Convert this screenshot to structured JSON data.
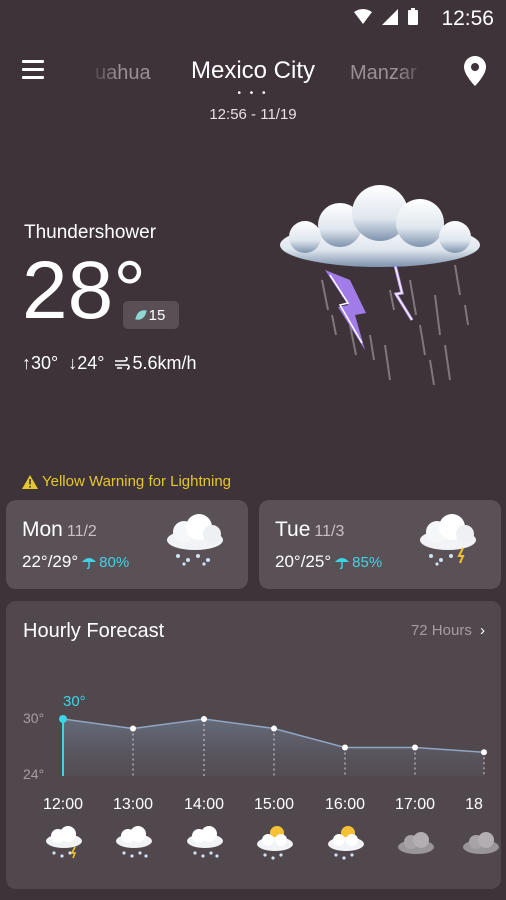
{
  "status_bar": {
    "time": "12:56"
  },
  "header": {
    "prev_city": "Chihuahua",
    "prev_city_visible": "uahua",
    "current_city": "Mexico City",
    "next_city": "Manzanillo",
    "next_city_visible": "Manzar",
    "page_dots": "• • •",
    "datetime": "12:56 - 11/19"
  },
  "current": {
    "condition": "Thundershower",
    "temperature": "28°",
    "aqi": "15",
    "high": "↑30°",
    "low": "↓24°",
    "wind": "5.6km/h"
  },
  "warning": {
    "text": "Yellow Warning for Lightning"
  },
  "daily": [
    {
      "day": "Mon",
      "date": "11/2",
      "temps": "22°/29°",
      "precip": "80%",
      "icon": "rain-cloud-icon"
    },
    {
      "day": "Tue",
      "date": "11/3",
      "temps": "20°/25°",
      "precip": "85%",
      "icon": "rain-thunder-cloud-icon"
    }
  ],
  "hourly": {
    "title": "Hourly Forecast",
    "link": "72 Hours",
    "max_label": "30°",
    "axis_high": "30°",
    "axis_low": "24°",
    "hours": [
      "12:00",
      "13:00",
      "14:00",
      "15:00",
      "16:00",
      "17:00",
      "18"
    ],
    "temps": [
      30,
      29,
      30,
      29,
      27,
      27,
      26.5
    ],
    "icons": [
      "thunder-rain-icon",
      "rain-icon",
      "rain-icon",
      "sun-rain-icon",
      "sun-rain-icon",
      "cloudy-icon",
      "cloudy-icon"
    ]
  },
  "colors": {
    "accent": "#3fd3e6",
    "warning": "#e6c62f",
    "background": "#3d3339",
    "card": "#5a5157"
  }
}
